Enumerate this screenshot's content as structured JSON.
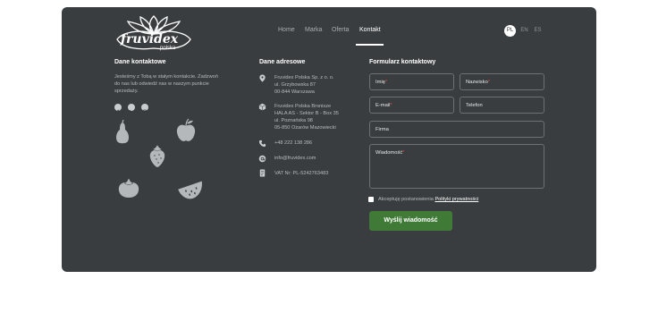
{
  "brand": {
    "logo_text": "fruvidex",
    "logo_sub": "polska"
  },
  "nav": {
    "items": [
      "Home",
      "Marka",
      "Oferta",
      "Kontakt"
    ],
    "active": "Kontakt"
  },
  "languages": [
    "PL",
    "EN",
    "ES"
  ],
  "contact": {
    "heading": "Dane kontaktowe",
    "intro": [
      "Jesteśmy z Tobą w stałym kontakcie. Zadzwoń",
      "do nas lub odwiedź nas w naszym punkcie",
      "sprzedaży."
    ],
    "social_icons": [
      "facebook-icon",
      "linkedin-icon",
      "instagram-icon"
    ]
  },
  "address": {
    "heading": "Dane adresowe",
    "office": [
      "Fruvidex Polska Sp. z o. o.",
      "ul. Grzybowska 87",
      "00-844 Warszawa"
    ],
    "warehouse": [
      "Fruvidex Polska Bronisze",
      "HALA AS - Sektor B - Box 35",
      "ul. Poznańska 98",
      "05-850 Ożarów Mazowiecki"
    ],
    "phone": "+48 222 138 286",
    "email": "info@fruvidex.com",
    "vat": "VAT Nr: PL-5242763483"
  },
  "form": {
    "heading": "Formularz kontaktowy",
    "first_name": "Imię",
    "last_name": "Nazwisko",
    "email": "E-mail",
    "phone": "Telefon",
    "company": "Firma",
    "message": "Wiadomość",
    "required_mark": "*",
    "consent_text": "Akceptuję postanowienia",
    "consent_link": "Polityki prywatności",
    "submit": "Wyślij wiadomość"
  },
  "colors": {
    "panel": "#3a3d3f",
    "button": "#3f7a36",
    "required": "#e0463c"
  }
}
